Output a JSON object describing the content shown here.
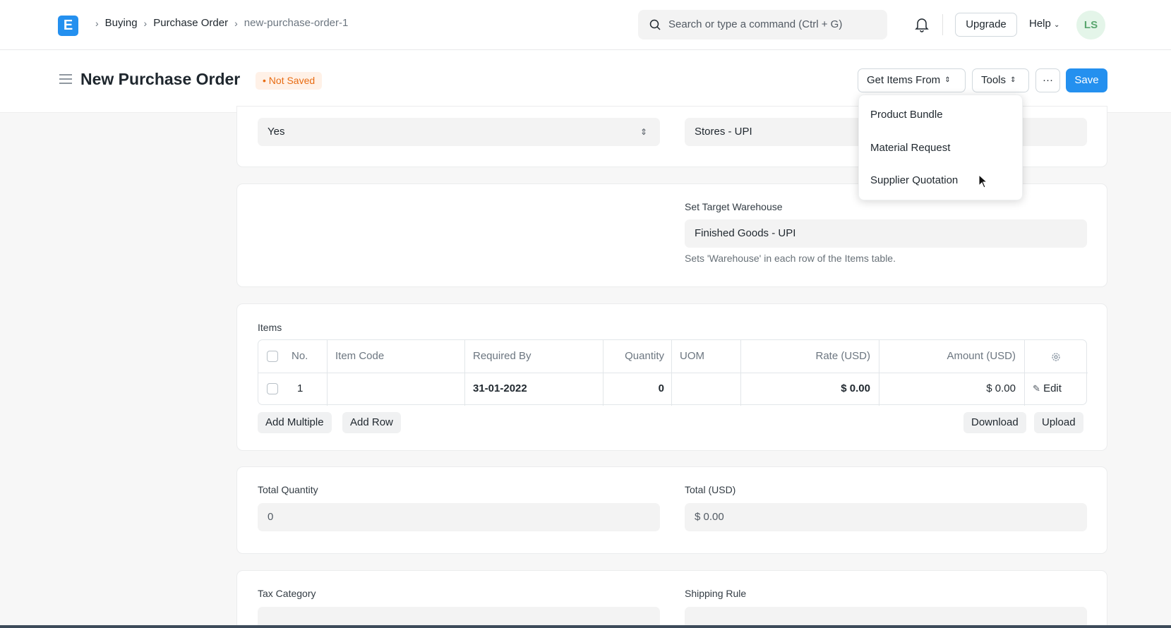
{
  "navbar": {
    "logo": "E",
    "breadcrumbs": [
      "Buying",
      "Purchase Order",
      "new-purchase-order-1"
    ],
    "search_placeholder": "Search or type a command (Ctrl + G)",
    "upgrade_label": "Upgrade",
    "help_label": "Help",
    "avatar_initials": "LS"
  },
  "page_head": {
    "title": "New Purchase Order",
    "status_badge": "Not Saved",
    "get_items_label": "Get Items From",
    "tools_label": "Tools",
    "more_label": "···",
    "save_label": "Save"
  },
  "dropdown": {
    "items": [
      "Product Bundle",
      "Material Request",
      "Supplier Quotation"
    ]
  },
  "section_top": {
    "select_value": "Yes",
    "warehouse_value": "Stores - UPI"
  },
  "section_target": {
    "label": "Set Target Warehouse",
    "value": "Finished Goods - UPI",
    "hint": "Sets 'Warehouse' in each row of the Items table."
  },
  "items": {
    "label": "Items",
    "columns": [
      "No.",
      "Item Code",
      "Required By",
      "Quantity",
      "UOM",
      "Rate (USD)",
      "Amount (USD)"
    ],
    "row": {
      "no": "1",
      "item_code": "",
      "required_by": "31-01-2022",
      "quantity": "0",
      "uom": "",
      "rate": "$ 0.00",
      "amount": "$ 0.00",
      "edit": "Edit"
    },
    "add_multiple": "Add Multiple",
    "add_row": "Add Row",
    "download": "Download",
    "upload": "Upload"
  },
  "totals": {
    "qty_label": "Total Quantity",
    "qty_value": "0",
    "total_label": "Total (USD)",
    "total_value": "$ 0.00"
  },
  "tax": {
    "tax_category_label": "Tax Category",
    "shipping_rule_label": "Shipping Rule"
  },
  "colors": {
    "accent": "#2490ef",
    "badge": "#e86c13"
  }
}
